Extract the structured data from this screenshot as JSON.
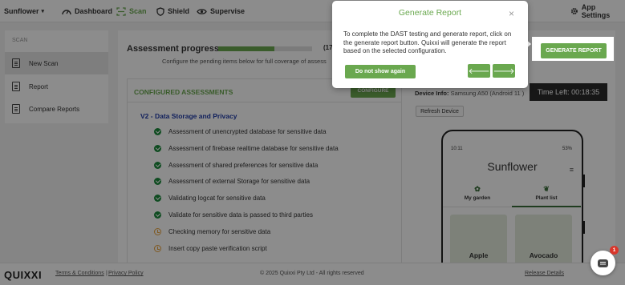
{
  "header": {
    "app_name": "Sunflower",
    "nav": [
      {
        "label": "Dashboard",
        "icon": "speedometer-icon"
      },
      {
        "label": "Scan",
        "icon": "scan-icon",
        "active": true
      },
      {
        "label": "Shield",
        "icon": "shield-icon"
      },
      {
        "label": "Supervise",
        "icon": "eye-icon"
      }
    ],
    "settings_label": "App Settings"
  },
  "sidebar": {
    "section_title": "SCAN",
    "items": [
      {
        "label": "New Scan",
        "icon": "document-icon",
        "active": true
      },
      {
        "label": "Report",
        "icon": "document-icon"
      },
      {
        "label": "Compare Reports",
        "icon": "document-icon"
      }
    ]
  },
  "progress": {
    "title": "Assessment progress",
    "fraction": 0.6,
    "count_text": "(17",
    "subtitle": "Configure the pending items below for full coverage of assess"
  },
  "assessments": {
    "header": "CONFIGURED ASSESSMENTS",
    "configure_label": "CONFIGURE",
    "section": "V2 - Data Storage and Privacy",
    "items": [
      {
        "label": "Assessment of unencrypted database for sensitive data",
        "status": "done"
      },
      {
        "label": "Assessment of firebase realtime database for sensitive data",
        "status": "done"
      },
      {
        "label": "Assessment of shared preferences for sensitive data",
        "status": "done"
      },
      {
        "label": "Assessment of external Storage for sensitive data",
        "status": "done"
      },
      {
        "label": "Validating logcat for sensitive data",
        "status": "done"
      },
      {
        "label": "Validate for sensitive data is passed to third parties",
        "status": "done"
      },
      {
        "label": "Checking memory for sensitive data",
        "status": "pending"
      },
      {
        "label": "Insert copy paste verification script",
        "status": "pending"
      }
    ]
  },
  "device": {
    "label": "Device Info:",
    "value": "Samsung A50 (Android 11 )",
    "timer": "Time Left: 00:18:35",
    "refresh_label": "Refresh Device"
  },
  "phone": {
    "time": "10:11",
    "battery": "53%",
    "title": "Sunflower",
    "tabs": [
      "My garden",
      "Plant list"
    ],
    "plants": [
      "Apple",
      "Avocado"
    ]
  },
  "tour": {
    "title": "Generate Report",
    "close": "×",
    "body": "To complete the DAST testing and generate report, click on the generate report button. Quixxi will generate the report based on the selected configuration.",
    "dismiss_label": "Do not show again",
    "prev_icon": "arrow-left-icon",
    "next_icon": "arrow-right-icon"
  },
  "generate_button": "GENERATE REPORT",
  "footer": {
    "logo": "QUIXXI",
    "terms": "Terms & Conditions",
    "separator": "|",
    "privacy": "Privacy Policy",
    "copyright": "© 2025 Quixxi Pty Ltd - All rights reserved",
    "release": "Release Details"
  },
  "chat": {
    "badge": "1"
  },
  "colors": {
    "accent": "#6aa84f",
    "section_blue": "#1f3ba8",
    "done": "#1c8a3c",
    "pending": "#e8a33d"
  }
}
